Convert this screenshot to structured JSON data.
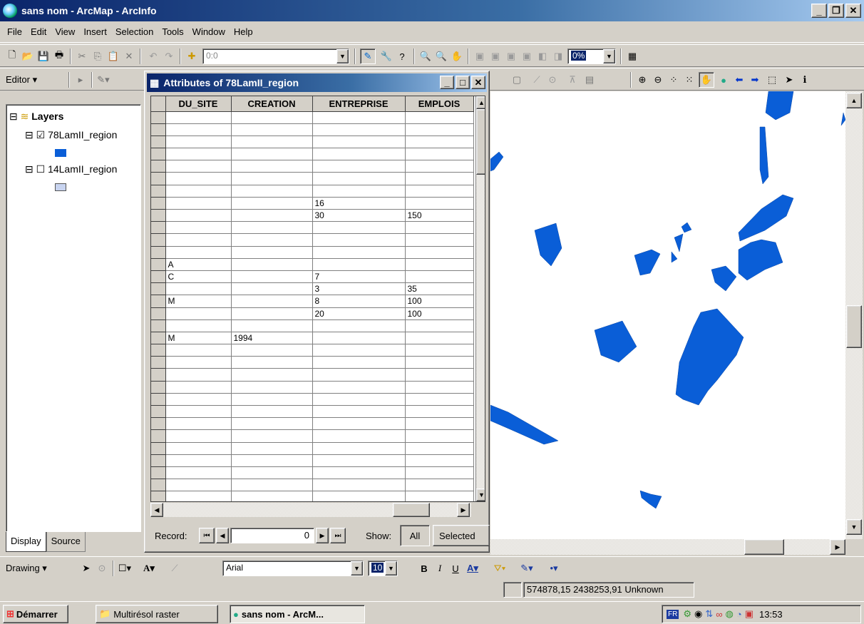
{
  "window": {
    "title": "sans nom - ArcMap - ArcInfo"
  },
  "menu": [
    "File",
    "Edit",
    "View",
    "Insert",
    "Selection",
    "Tools",
    "Window",
    "Help"
  ],
  "toolbar": {
    "scale_value": "0:0",
    "zoom_pct": "0%"
  },
  "editor": {
    "label": "Editor"
  },
  "toc": {
    "root": "Layers",
    "layers": [
      {
        "name": "78LamII_region",
        "checked": true,
        "color": "#0a5ed7"
      },
      {
        "name": "14LamII_region",
        "checked": false,
        "color": "#c8d4f0"
      }
    ],
    "tabs": {
      "display": "Display",
      "source": "Source"
    }
  },
  "attr": {
    "title": "Attributes of 78LamII_region",
    "columns": [
      "DU_SITE",
      "CREATION",
      "ENTREPRISE",
      "EMPLOIS"
    ],
    "rows": [
      [
        "",
        "",
        "",
        ""
      ],
      [
        "",
        "",
        "",
        ""
      ],
      [
        "",
        "",
        "",
        ""
      ],
      [
        "",
        "",
        "",
        ""
      ],
      [
        "",
        "",
        "",
        ""
      ],
      [
        "",
        "",
        "",
        ""
      ],
      [
        "",
        "",
        "",
        ""
      ],
      [
        "",
        "",
        "16",
        ""
      ],
      [
        "",
        "",
        "30",
        "150"
      ],
      [
        "",
        "",
        "",
        ""
      ],
      [
        "",
        "",
        "",
        ""
      ],
      [
        "",
        "",
        "",
        ""
      ],
      [
        "A",
        "",
        "",
        ""
      ],
      [
        "C",
        "",
        "7",
        ""
      ],
      [
        "",
        "",
        "3",
        "35"
      ],
      [
        "M",
        "",
        "8",
        "100"
      ],
      [
        "",
        "",
        "20",
        "100"
      ],
      [
        "",
        "",
        "",
        ""
      ],
      [
        "M",
        "1994",
        "",
        ""
      ],
      [
        "",
        "",
        "",
        ""
      ],
      [
        "",
        "",
        "",
        ""
      ],
      [
        "",
        "",
        "",
        ""
      ],
      [
        "",
        "",
        "",
        ""
      ],
      [
        "",
        "",
        "",
        ""
      ],
      [
        "",
        "",
        "",
        ""
      ],
      [
        "",
        "",
        "",
        ""
      ],
      [
        "",
        "",
        "",
        ""
      ],
      [
        "",
        "",
        "",
        ""
      ],
      [
        "",
        "",
        "",
        ""
      ],
      [
        "",
        "",
        "",
        ""
      ],
      [
        "",
        "",
        "",
        ""
      ],
      [
        "",
        "",
        "",
        ""
      ]
    ],
    "record_label": "Record:",
    "record_value": "0",
    "show_label": "Show:",
    "show_all": "All",
    "show_selected": "Selected"
  },
  "drawing": {
    "label": "Drawing",
    "font": "Arial",
    "size": "10"
  },
  "status": {
    "coords": "574878,15  2438253,91 Unknown"
  },
  "taskbar": {
    "start": "Démarrer",
    "tasks": [
      "Multirésol raster",
      "sans nom - ArcM..."
    ],
    "lang": "FR",
    "clock": "13:53"
  },
  "colors": {
    "feature": "#0a5ed7",
    "title_active": "#0a246a"
  }
}
